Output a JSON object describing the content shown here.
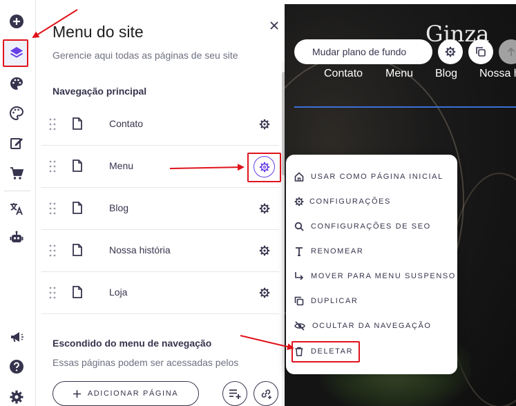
{
  "panel": {
    "title": "Menu do site",
    "subtitle": "Gerencie aqui todas as páginas de seu site",
    "main_nav_title": "Navegação principal",
    "hidden_title": "Escondido do menu de navegação",
    "hidden_sub": "Essas páginas podem ser acessadas pelos",
    "add_page_label": "ADICIONAR PÁGINA",
    "pages": [
      {
        "label": "Contato"
      },
      {
        "label": "Menu"
      },
      {
        "label": "Blog"
      },
      {
        "label": "Nossa história"
      },
      {
        "label": "Loja"
      }
    ]
  },
  "preview": {
    "brand": "Ginza",
    "change_bg_label": "Mudar plano de fundo",
    "nav": [
      "Contato",
      "Menu",
      "Blog",
      "Nossa h"
    ]
  },
  "context_menu": {
    "items": [
      {
        "label": "USAR COMO PÁGINA INICIAL",
        "icon": "home-icon"
      },
      {
        "label": "CONFIGURAÇÕES",
        "icon": "gear-icon"
      },
      {
        "label": "CONFIGURAÇÕES DE SEO",
        "icon": "search-icon"
      },
      {
        "label": "RENOMEAR",
        "icon": "text-icon"
      },
      {
        "label": "MOVER PARA MENU SUSPENSO",
        "icon": "arrow-down-right-icon"
      },
      {
        "label": "DUPLICAR",
        "icon": "duplicate-icon"
      },
      {
        "label": "OCULTAR DA NAVEGAÇÃO",
        "icon": "eye-off-icon"
      },
      {
        "label": "DELETAR",
        "icon": "trash-icon"
      }
    ]
  },
  "colors": {
    "accent": "#673de6",
    "highlight": "#e0121b",
    "text": "#36344d"
  }
}
